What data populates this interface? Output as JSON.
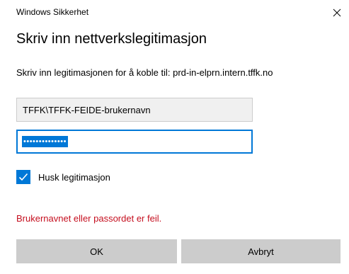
{
  "window": {
    "title": "Windows Sikkerhet",
    "close_icon": "close-icon"
  },
  "dialog": {
    "heading": "Skriv inn nettverkslegitimasjon",
    "prompt": "Skriv inn legitimasjonen for å koble til: prd-in-elprn.intern.tffk.no"
  },
  "form": {
    "username_value": "TFFK\\TFFK-FEIDE-brukernavn",
    "password_masked": "••••••••••••••",
    "password_selected": true,
    "remember_label": "Husk legitimasjon",
    "remember_checked": true
  },
  "error": {
    "message": "Brukernavnet eller passordet er feil."
  },
  "buttons": {
    "ok_label": "OK",
    "cancel_label": "Avbryt"
  },
  "colors": {
    "accent": "#0078d7",
    "error": "#c50f1f",
    "button_bg": "#cccccc",
    "field_bg": "#f0f0f0"
  }
}
